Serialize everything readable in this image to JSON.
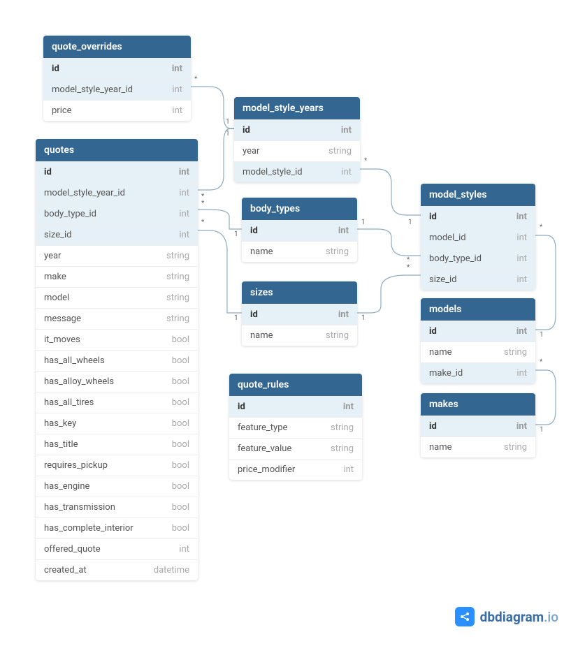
{
  "tables": {
    "quote_overrides": {
      "title": "quote_overrides",
      "columns": [
        {
          "name": "id",
          "type": "int",
          "pk": true
        },
        {
          "name": "model_style_year_id",
          "type": "int",
          "fk": true
        },
        {
          "name": "price",
          "type": "int"
        }
      ]
    },
    "quotes": {
      "title": "quotes",
      "columns": [
        {
          "name": "id",
          "type": "int",
          "pk": true
        },
        {
          "name": "model_style_year_id",
          "type": "int",
          "fk": true
        },
        {
          "name": "body_type_id",
          "type": "int",
          "fk": true
        },
        {
          "name": "size_id",
          "type": "int",
          "fk": true
        },
        {
          "name": "year",
          "type": "string"
        },
        {
          "name": "make",
          "type": "string"
        },
        {
          "name": "model",
          "type": "string"
        },
        {
          "name": "message",
          "type": "string"
        },
        {
          "name": "it_moves",
          "type": "bool"
        },
        {
          "name": "has_all_wheels",
          "type": "bool"
        },
        {
          "name": "has_alloy_wheels",
          "type": "bool"
        },
        {
          "name": "has_all_tires",
          "type": "bool"
        },
        {
          "name": "has_key",
          "type": "bool"
        },
        {
          "name": "has_title",
          "type": "bool"
        },
        {
          "name": "requires_pickup",
          "type": "bool"
        },
        {
          "name": "has_engine",
          "type": "bool"
        },
        {
          "name": "has_transmission",
          "type": "bool"
        },
        {
          "name": "has_complete_interior",
          "type": "bool"
        },
        {
          "name": "offered_quote",
          "type": "int"
        },
        {
          "name": "created_at",
          "type": "datetime"
        }
      ]
    },
    "model_style_years": {
      "title": "model_style_years",
      "columns": [
        {
          "name": "id",
          "type": "int",
          "pk": true
        },
        {
          "name": "year",
          "type": "string"
        },
        {
          "name": "model_style_id",
          "type": "int",
          "fk": true
        }
      ]
    },
    "body_types": {
      "title": "body_types",
      "columns": [
        {
          "name": "id",
          "type": "int",
          "pk": true
        },
        {
          "name": "name",
          "type": "string"
        }
      ]
    },
    "sizes": {
      "title": "sizes",
      "columns": [
        {
          "name": "id",
          "type": "int",
          "pk": true
        },
        {
          "name": "name",
          "type": "string"
        }
      ]
    },
    "quote_rules": {
      "title": "quote_rules",
      "columns": [
        {
          "name": "id",
          "type": "int",
          "pk": true
        },
        {
          "name": "feature_type",
          "type": "string"
        },
        {
          "name": "feature_value",
          "type": "string"
        },
        {
          "name": "price_modifier",
          "type": "int"
        }
      ]
    },
    "model_styles": {
      "title": "model_styles",
      "columns": [
        {
          "name": "id",
          "type": "int",
          "pk": true
        },
        {
          "name": "model_id",
          "type": "int",
          "fk": true
        },
        {
          "name": "body_type_id",
          "type": "int",
          "fk": true
        },
        {
          "name": "size_id",
          "type": "int",
          "fk": true
        }
      ]
    },
    "models": {
      "title": "models",
      "columns": [
        {
          "name": "id",
          "type": "int",
          "pk": true
        },
        {
          "name": "name",
          "type": "string"
        },
        {
          "name": "make_id",
          "type": "int",
          "fk": true
        }
      ]
    },
    "makes": {
      "title": "makes",
      "columns": [
        {
          "name": "id",
          "type": "int",
          "pk": true
        },
        {
          "name": "name",
          "type": "string"
        }
      ]
    }
  },
  "cardinalities": {
    "c1": "*",
    "c2": "1",
    "c3": "1",
    "c4": "*",
    "c5": "*",
    "c6": "*",
    "c7": "1",
    "c8": "1",
    "c9": "1",
    "c10": "1",
    "c11": "1",
    "c12": "*",
    "c13": "*",
    "c14": "*",
    "c15": "*",
    "c16": "1",
    "c17": "*",
    "c18": "1"
  },
  "watermark": {
    "brand_strong": "dbdiagram",
    "brand_light": ".io"
  }
}
